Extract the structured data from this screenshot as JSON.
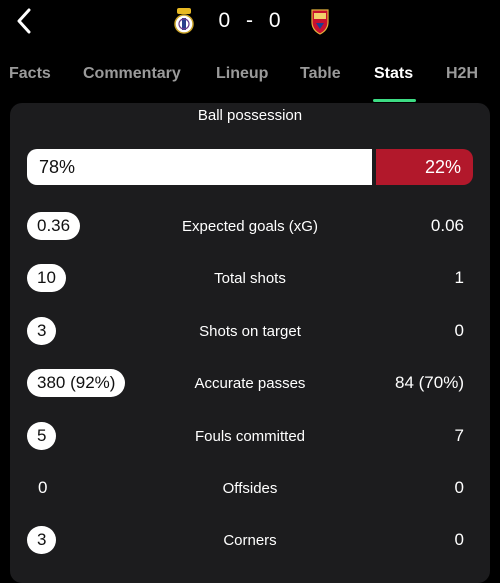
{
  "header": {
    "score": "0 - 0",
    "home_crest_icon": "real-madrid-crest-icon",
    "away_crest_icon": "osasuna-crest-icon"
  },
  "tabs": [
    {
      "label": "Facts",
      "active": false
    },
    {
      "label": "Commentary",
      "active": false
    },
    {
      "label": "Lineup",
      "active": false
    },
    {
      "label": "Table",
      "active": false
    },
    {
      "label": "Stats",
      "active": true
    },
    {
      "label": "H2H",
      "active": false
    }
  ],
  "colors": {
    "accent": "#3ddc84",
    "away": "#b2182b",
    "home": "#ffffff",
    "panel": "#1c1c1e"
  },
  "possession": {
    "title": "Ball possession",
    "home": "78%",
    "away": "22%",
    "home_fraction": 0.78
  },
  "stats": [
    {
      "label": "Expected goals (xG)",
      "home": "0.36",
      "away": "0.06",
      "home_highlight": true
    },
    {
      "label": "Total shots",
      "home": "10",
      "away": "1",
      "home_highlight": true
    },
    {
      "label": "Shots on target",
      "home": "3",
      "away": "0",
      "home_highlight": true
    },
    {
      "label": "Accurate passes",
      "home": "380 (92%)",
      "away": "84 (70%)",
      "home_highlight": true
    },
    {
      "label": "Fouls committed",
      "home": "5",
      "away": "7",
      "home_highlight": true
    },
    {
      "label": "Offsides",
      "home": "0",
      "away": "0",
      "home_highlight": false
    },
    {
      "label": "Corners",
      "home": "3",
      "away": "0",
      "home_highlight": true
    }
  ]
}
